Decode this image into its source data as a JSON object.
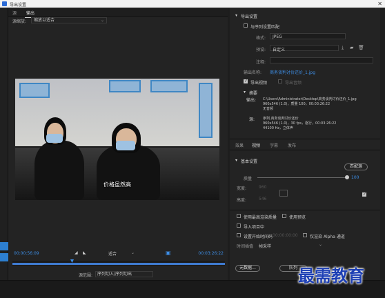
{
  "window": {
    "title": "导出设置",
    "close": "✕"
  },
  "left": {
    "tabs": [
      "源",
      "输出"
    ],
    "scale_label": "源缩放:",
    "scale_value": "缩放以适合",
    "subtitle": "价格虽然高",
    "timecode_in": "00:00:56:09",
    "fit_value": "适合",
    "timecode_out": "00:03:26:22",
    "range_label": "源范围:",
    "range_value": "序列切入/序列切出"
  },
  "export": {
    "section_title": "导出设置",
    "match_sequence": "与序列设置匹配",
    "format_label": "格式:",
    "format_value": "JPEG",
    "preset_label": "预设:",
    "preset_value": "自定义",
    "comment_label": "注释:",
    "output_label": "输出名称:",
    "output_value": "商务谈判讨价还价_1.jpg",
    "export_video": "导出视频",
    "export_audio": "导出音频",
    "summary_title": "摘要",
    "output_key": "输出:",
    "output_path": "C:\\Users\\Administrator\\Desktop\\商务谈判讨价还价_1.jpg",
    "output_detail": "960x546 (1.0)，质量 100，00:03:26:22",
    "output_audio": "无音频",
    "source_key": "源:",
    "source_name": "序列,商务谈判讨价还价",
    "source_detail": "960x546 (1.0)，30 fps，逐行，00:03:26:22",
    "source_audio": "44100 Hz，立体声"
  },
  "tabs": [
    "效果",
    "视频",
    "字幕",
    "发布"
  ],
  "video": {
    "section_title": "基本设置",
    "match_source": "匹配源",
    "quality_label": "质量",
    "quality_value": "100",
    "quality_fraction": 1.0,
    "width_label": "宽度:",
    "width_value": "960",
    "height_label": "高度:",
    "height_value": "546"
  },
  "options": {
    "max_render": "使用最高渲染质量",
    "use_preview": "使用预览",
    "import_project": "导入项目中",
    "set_start_tc": "设置开始时间码",
    "start_tc_value": "00:00:00:00",
    "render_alpha": "仅渲染 Alpha 通道",
    "interp_label": "时间插值",
    "interp_value": "帧采样"
  },
  "buttons": {
    "metadata": "元数据...",
    "queue": "队列"
  },
  "watermark": "最需教育",
  "colors": {
    "accent": "#3d8ee6",
    "panel": "#232323"
  }
}
